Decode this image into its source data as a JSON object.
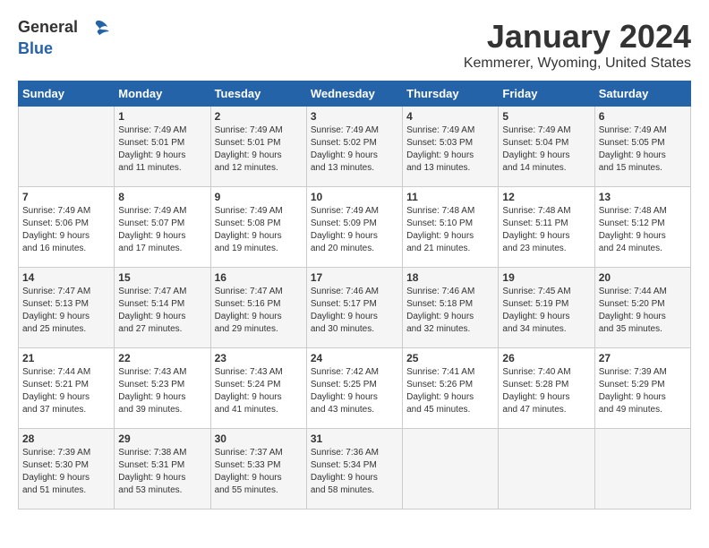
{
  "header": {
    "logo_general": "General",
    "logo_blue": "Blue",
    "month_title": "January 2024",
    "location": "Kemmerer, Wyoming, United States"
  },
  "weekdays": [
    "Sunday",
    "Monday",
    "Tuesday",
    "Wednesday",
    "Thursday",
    "Friday",
    "Saturday"
  ],
  "weeks": [
    [
      {
        "day": "",
        "info": ""
      },
      {
        "day": "1",
        "info": "Sunrise: 7:49 AM\nSunset: 5:01 PM\nDaylight: 9 hours\nand 11 minutes."
      },
      {
        "day": "2",
        "info": "Sunrise: 7:49 AM\nSunset: 5:01 PM\nDaylight: 9 hours\nand 12 minutes."
      },
      {
        "day": "3",
        "info": "Sunrise: 7:49 AM\nSunset: 5:02 PM\nDaylight: 9 hours\nand 13 minutes."
      },
      {
        "day": "4",
        "info": "Sunrise: 7:49 AM\nSunset: 5:03 PM\nDaylight: 9 hours\nand 13 minutes."
      },
      {
        "day": "5",
        "info": "Sunrise: 7:49 AM\nSunset: 5:04 PM\nDaylight: 9 hours\nand 14 minutes."
      },
      {
        "day": "6",
        "info": "Sunrise: 7:49 AM\nSunset: 5:05 PM\nDaylight: 9 hours\nand 15 minutes."
      }
    ],
    [
      {
        "day": "7",
        "info": "Sunrise: 7:49 AM\nSunset: 5:06 PM\nDaylight: 9 hours\nand 16 minutes."
      },
      {
        "day": "8",
        "info": "Sunrise: 7:49 AM\nSunset: 5:07 PM\nDaylight: 9 hours\nand 17 minutes."
      },
      {
        "day": "9",
        "info": "Sunrise: 7:49 AM\nSunset: 5:08 PM\nDaylight: 9 hours\nand 19 minutes."
      },
      {
        "day": "10",
        "info": "Sunrise: 7:49 AM\nSunset: 5:09 PM\nDaylight: 9 hours\nand 20 minutes."
      },
      {
        "day": "11",
        "info": "Sunrise: 7:48 AM\nSunset: 5:10 PM\nDaylight: 9 hours\nand 21 minutes."
      },
      {
        "day": "12",
        "info": "Sunrise: 7:48 AM\nSunset: 5:11 PM\nDaylight: 9 hours\nand 23 minutes."
      },
      {
        "day": "13",
        "info": "Sunrise: 7:48 AM\nSunset: 5:12 PM\nDaylight: 9 hours\nand 24 minutes."
      }
    ],
    [
      {
        "day": "14",
        "info": "Sunrise: 7:47 AM\nSunset: 5:13 PM\nDaylight: 9 hours\nand 25 minutes."
      },
      {
        "day": "15",
        "info": "Sunrise: 7:47 AM\nSunset: 5:14 PM\nDaylight: 9 hours\nand 27 minutes."
      },
      {
        "day": "16",
        "info": "Sunrise: 7:47 AM\nSunset: 5:16 PM\nDaylight: 9 hours\nand 29 minutes."
      },
      {
        "day": "17",
        "info": "Sunrise: 7:46 AM\nSunset: 5:17 PM\nDaylight: 9 hours\nand 30 minutes."
      },
      {
        "day": "18",
        "info": "Sunrise: 7:46 AM\nSunset: 5:18 PM\nDaylight: 9 hours\nand 32 minutes."
      },
      {
        "day": "19",
        "info": "Sunrise: 7:45 AM\nSunset: 5:19 PM\nDaylight: 9 hours\nand 34 minutes."
      },
      {
        "day": "20",
        "info": "Sunrise: 7:44 AM\nSunset: 5:20 PM\nDaylight: 9 hours\nand 35 minutes."
      }
    ],
    [
      {
        "day": "21",
        "info": "Sunrise: 7:44 AM\nSunset: 5:21 PM\nDaylight: 9 hours\nand 37 minutes."
      },
      {
        "day": "22",
        "info": "Sunrise: 7:43 AM\nSunset: 5:23 PM\nDaylight: 9 hours\nand 39 minutes."
      },
      {
        "day": "23",
        "info": "Sunrise: 7:43 AM\nSunset: 5:24 PM\nDaylight: 9 hours\nand 41 minutes."
      },
      {
        "day": "24",
        "info": "Sunrise: 7:42 AM\nSunset: 5:25 PM\nDaylight: 9 hours\nand 43 minutes."
      },
      {
        "day": "25",
        "info": "Sunrise: 7:41 AM\nSunset: 5:26 PM\nDaylight: 9 hours\nand 45 minutes."
      },
      {
        "day": "26",
        "info": "Sunrise: 7:40 AM\nSunset: 5:28 PM\nDaylight: 9 hours\nand 47 minutes."
      },
      {
        "day": "27",
        "info": "Sunrise: 7:39 AM\nSunset: 5:29 PM\nDaylight: 9 hours\nand 49 minutes."
      }
    ],
    [
      {
        "day": "28",
        "info": "Sunrise: 7:39 AM\nSunset: 5:30 PM\nDaylight: 9 hours\nand 51 minutes."
      },
      {
        "day": "29",
        "info": "Sunrise: 7:38 AM\nSunset: 5:31 PM\nDaylight: 9 hours\nand 53 minutes."
      },
      {
        "day": "30",
        "info": "Sunrise: 7:37 AM\nSunset: 5:33 PM\nDaylight: 9 hours\nand 55 minutes."
      },
      {
        "day": "31",
        "info": "Sunrise: 7:36 AM\nSunset: 5:34 PM\nDaylight: 9 hours\nand 58 minutes."
      },
      {
        "day": "",
        "info": ""
      },
      {
        "day": "",
        "info": ""
      },
      {
        "day": "",
        "info": ""
      }
    ]
  ]
}
